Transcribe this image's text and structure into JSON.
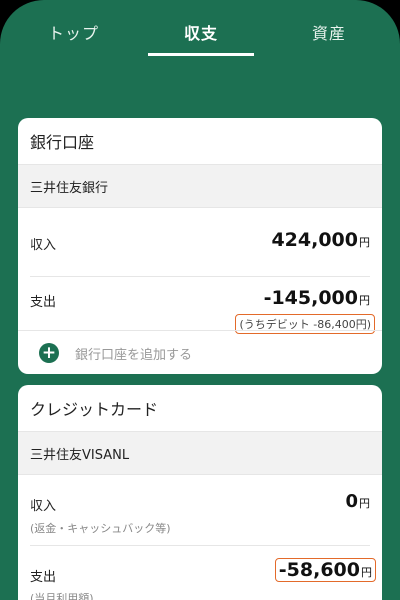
{
  "tabs": [
    "トップ",
    "収支",
    "資産"
  ],
  "bank_card": {
    "title": "銀行口座",
    "bank_name": "三井住友銀行",
    "income_label": "収入",
    "income_amount": "424,000",
    "expense_label": "支出",
    "expense_amount": "-145,000",
    "debit_note": "(うちデビット -86,400円)",
    "add_label": "銀行口座を追加する",
    "unit": "円"
  },
  "credit_card": {
    "title": "クレジットカード",
    "card_name": "三井住友VISANL",
    "income_label": "収入",
    "income_amount": "0",
    "income_note": "(返金・キャッシュバック等)",
    "expense_label": "支出",
    "expense_amount": "-58,600",
    "expense_note": "(当月利用額)",
    "unit": "円"
  },
  "colors": {
    "brand": "#1c7052",
    "highlight": "#e36a2a"
  }
}
